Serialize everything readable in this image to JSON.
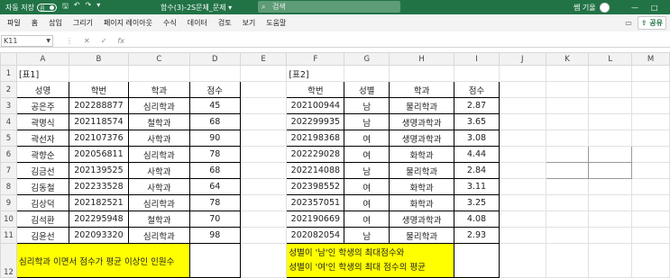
{
  "titlebar": {
    "autosave_label": "자동 저장",
    "toggle_state": "끔",
    "file_title": "함수(3)-2S문제_문제 ▾",
    "search_placeholder": "검색",
    "user_name": "쌤 기울",
    "min_label": "—",
    "max_label": "□"
  },
  "ribbon": {
    "tabs": [
      "파일",
      "홈",
      "삽입",
      "그리기",
      "페이지 레이아웃",
      "수식",
      "데이터",
      "검토",
      "보기",
      "도움말"
    ],
    "share_label": "공유"
  },
  "formula_bar": {
    "cell_ref": "K11",
    "fx_label": "fx",
    "content": ""
  },
  "columns": [
    "A",
    "B",
    "C",
    "D",
    "E",
    "F",
    "G",
    "H",
    "I",
    "J",
    "K",
    "L",
    "M"
  ],
  "rows": [
    "1",
    "2",
    "3",
    "4",
    "5",
    "6",
    "7",
    "8",
    "9",
    "10",
    "11",
    "12"
  ],
  "table1": {
    "title": "[표1]",
    "headers": [
      "성명",
      "학번",
      "학과",
      "점수"
    ],
    "rows": [
      [
        "공은주",
        "202288877",
        "심리학과",
        "45"
      ],
      [
        "곽명식",
        "202118574",
        "철학과",
        "68"
      ],
      [
        "곽선자",
        "202107376",
        "사학과",
        "90"
      ],
      [
        "곽향순",
        "202056811",
        "심리학과",
        "78"
      ],
      [
        "김금선",
        "202139525",
        "사학과",
        "68"
      ],
      [
        "김동철",
        "202233528",
        "사학과",
        "64"
      ],
      [
        "김상덕",
        "202182521",
        "심리학과",
        "78"
      ],
      [
        "김석환",
        "202295948",
        "철학과",
        "70"
      ],
      [
        "김윤선",
        "202093320",
        "심리학과",
        "98"
      ]
    ],
    "question": "심리학과 이면서 점수가 평균 이상인 인원수"
  },
  "table2": {
    "title": "[표2]",
    "headers": [
      "학번",
      "성별",
      "학과",
      "점수"
    ],
    "rows": [
      [
        "202100944",
        "남",
        "물리학과",
        "2.87"
      ],
      [
        "202299935",
        "남",
        "생명과학과",
        "3.65"
      ],
      [
        "202198368",
        "여",
        "생명과학과",
        "3.08"
      ],
      [
        "202229028",
        "여",
        "화학과",
        "4.44"
      ],
      [
        "202214088",
        "남",
        "물리학과",
        "2.84"
      ],
      [
        "202398552",
        "여",
        "화학과",
        "3.11"
      ],
      [
        "202357051",
        "여",
        "화학과",
        "3.25"
      ],
      [
        "202190669",
        "여",
        "생명과학과",
        "4.08"
      ],
      [
        "202082054",
        "남",
        "물리학과",
        "2.93"
      ]
    ],
    "question_line1": "성별이 '남'인 학생의 최대점수와",
    "question_line2": "성별이 '여'인 학생의 최대 점수의 평균"
  },
  "colors": {
    "excel_green": "#217346",
    "highlight": "#ffff00"
  }
}
